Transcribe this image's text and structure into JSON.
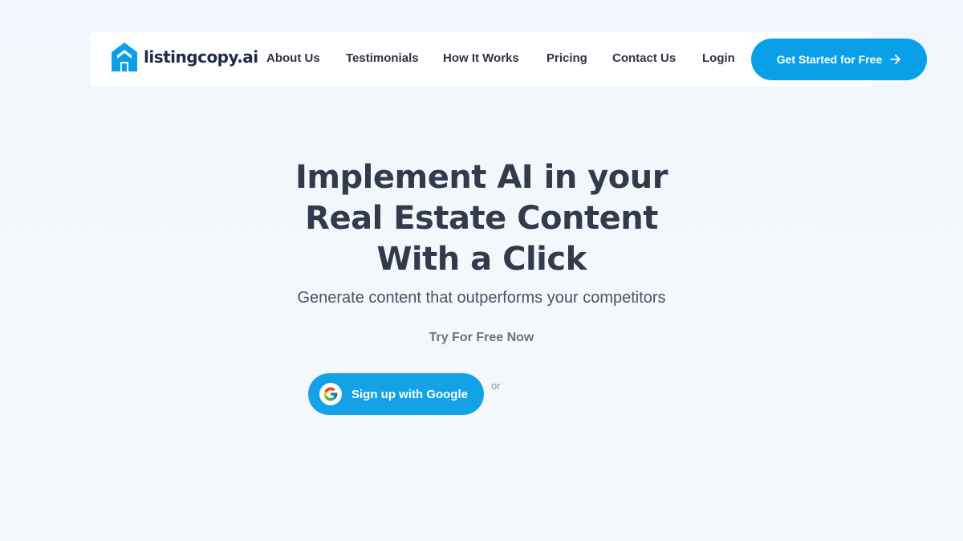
{
  "brand": {
    "name": "listingcopy.ai",
    "accent_color": "#0aa0e8",
    "logo_color": "#0aa0e8"
  },
  "nav": {
    "items": [
      {
        "label": "About Us"
      },
      {
        "label": "Testimonials"
      },
      {
        "label": "How It Works"
      },
      {
        "label": "Pricing"
      },
      {
        "label": "Contact Us"
      },
      {
        "label": "Login"
      }
    ],
    "cta_label": "Get Started for Free",
    "cta_icon": "arrow-right-icon"
  },
  "hero": {
    "title_lines": [
      "Implement AI in your",
      "Real Estate Content",
      "With a Click"
    ],
    "subtitle": "Generate content that outperforms your competitors",
    "try_label": "Try For Free Now",
    "google_button_label": "Sign up with Google",
    "google_icon": "google-icon",
    "or_text": "or"
  }
}
